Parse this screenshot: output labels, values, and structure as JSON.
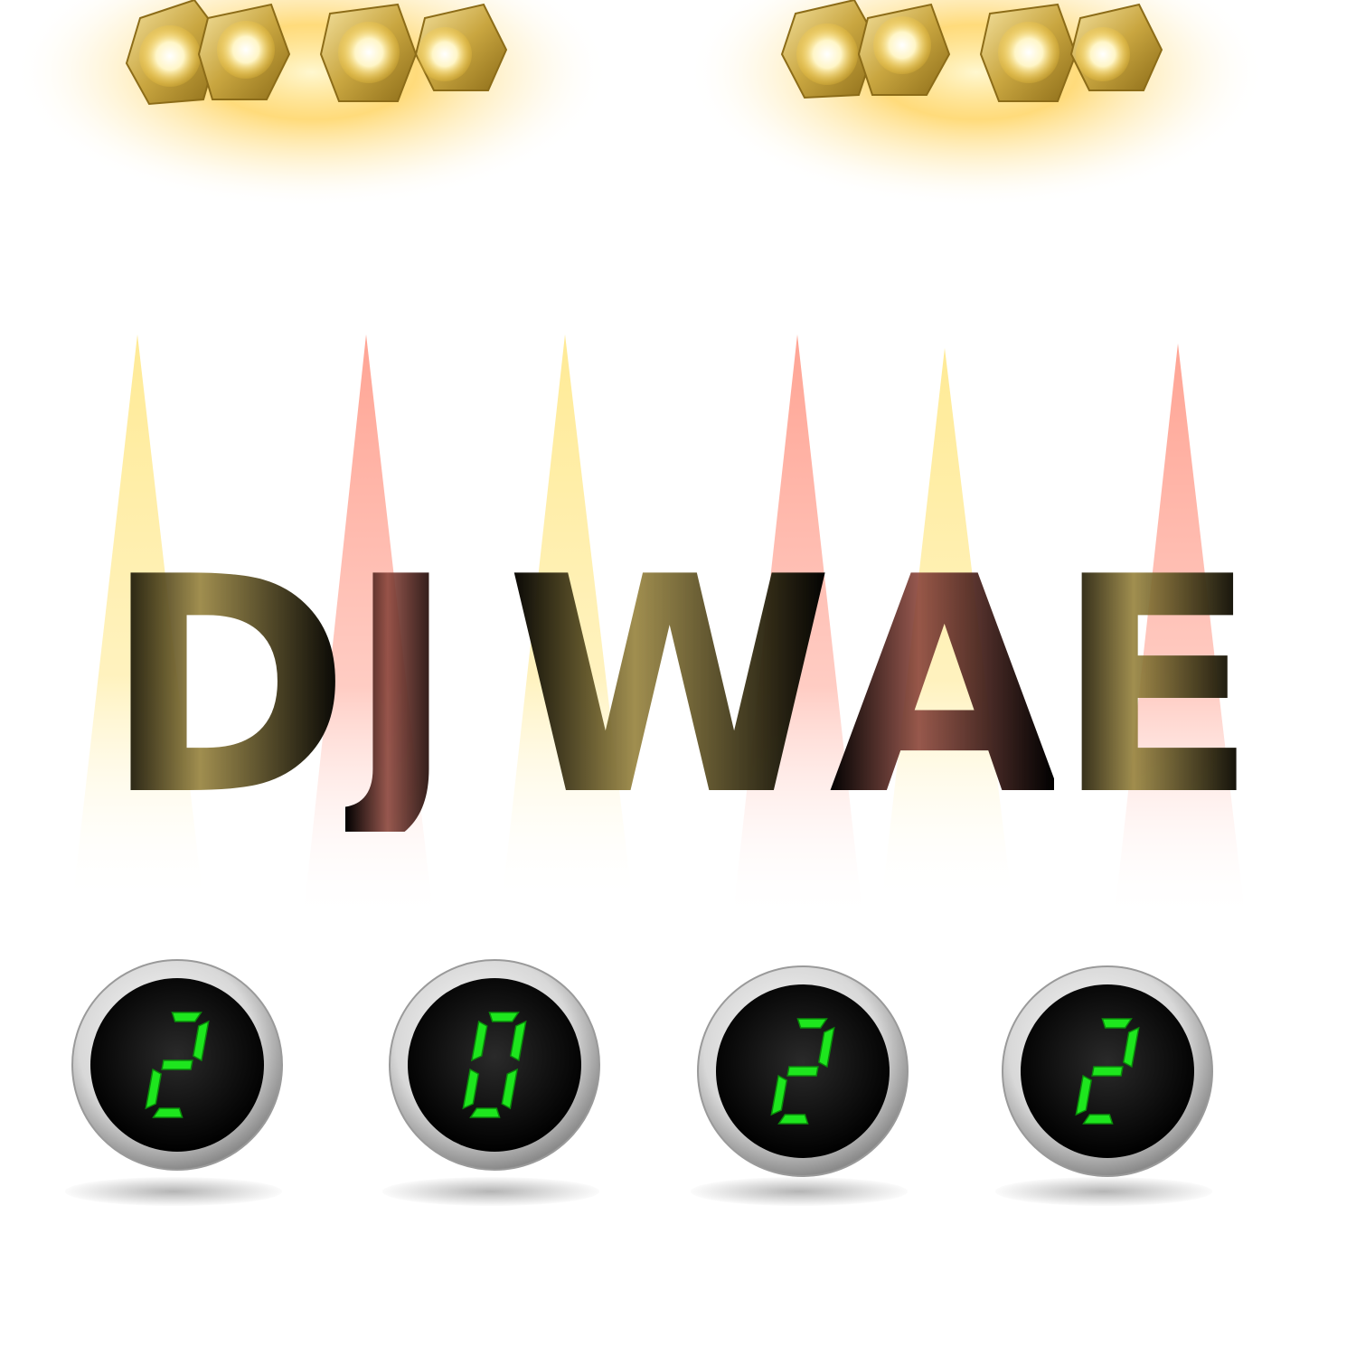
{
  "title": {
    "letters": [
      "D",
      "J",
      "W",
      "A",
      "E"
    ],
    "text": "DJ WAE"
  },
  "year": {
    "digits": [
      "2",
      "0",
      "2",
      "2"
    ]
  },
  "colors": {
    "beam_yellow": "#ffe88a",
    "beam_red": "#ff9a88",
    "lcd_green": "#1ee61e",
    "lamp_gold": "#c9a640",
    "glow": "#ffcc44"
  },
  "icons": {
    "spotlight_rig": "stage-spotlight-icon",
    "beam": "light-beam",
    "display": "seven-segment-display"
  }
}
